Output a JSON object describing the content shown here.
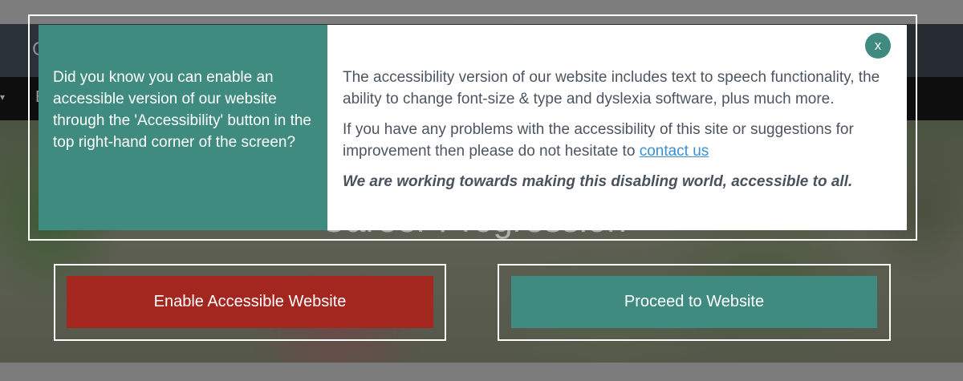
{
  "background": {
    "logo_fragment": "C",
    "nav_fragment": "E",
    "nav_caret": "▾",
    "hero_title": "Career Progression"
  },
  "modal": {
    "left_message": "Did you know you can enable an accessible version of our website through the 'Accessibility' button in the top right-hand corner of the screen?",
    "paragraph_1": "The accessibility version of our website includes text to speech functionality, the ability to change font-size & type and dyslexia software, plus much more.",
    "paragraph_2_text": "If you have any problems with the accessibility of this site or suggestions for improvement then please do not hesitate to ",
    "paragraph_2_link": "contact us",
    "emphasis": "We are working towards making this disabling world, accessible to all.",
    "close_label": "x"
  },
  "buttons": {
    "enable_label": "Enable Accessible Website",
    "proceed_label": "Proceed to Website"
  },
  "colors": {
    "teal": "#3f8b7f",
    "red": "#a3261f",
    "link": "#3b8fd0"
  }
}
